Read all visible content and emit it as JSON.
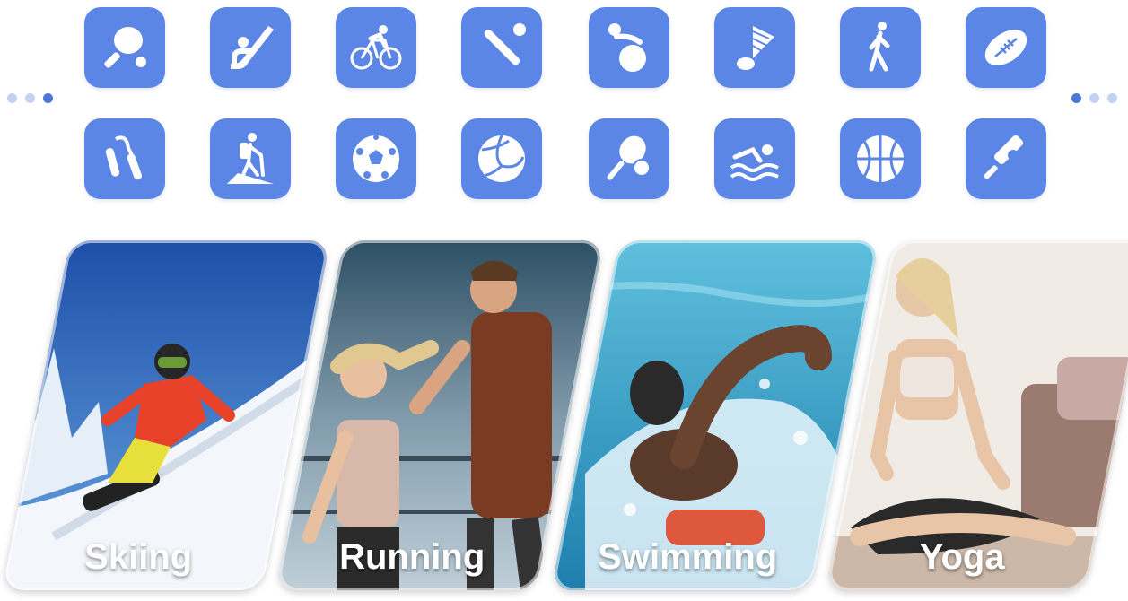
{
  "theme": {
    "tile_color": "#5b86e5",
    "dot_active": "#4a78d8",
    "dot_inactive": "#c3d2f2"
  },
  "icon_rows": [
    [
      "table-tennis-icon",
      "hockey-icon",
      "cycling-icon",
      "baseball-icon",
      "ball-exercise-icon",
      "badminton-icon",
      "walking-icon",
      "rugby-icon"
    ],
    [
      "hand-grip-icon",
      "hiking-icon",
      "soccer-icon",
      "volleyball-icon",
      "tennis-icon",
      "swimming-icon",
      "basketball-icon",
      "cricket-icon"
    ]
  ],
  "carousel": {
    "left_active_dot": 3,
    "right_active_dot": 1,
    "dot_count": 3
  },
  "cards": [
    {
      "label": "Skiing",
      "scene": "snowboarder on snowy slope"
    },
    {
      "label": "Running",
      "scene": "couple running outdoors"
    },
    {
      "label": "Swimming",
      "scene": "swimmer in pool"
    },
    {
      "label": "Yoga",
      "scene": "woman meditating on floor"
    }
  ]
}
